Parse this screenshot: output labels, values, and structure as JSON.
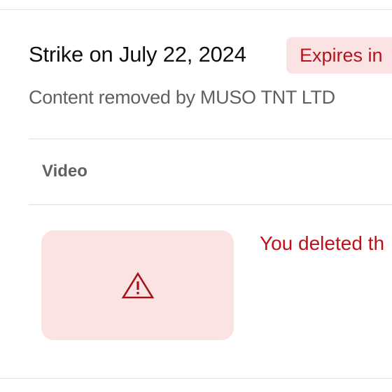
{
  "strike": {
    "title": "Strike on July 22, 2024",
    "badge": "Expires in",
    "removed_by": "Content removed by MUSO TNT LTD"
  },
  "table": {
    "header_video": "Video",
    "row": {
      "thumbnail_icon": "warning-triangle-icon",
      "status": "You deleted th"
    }
  },
  "colors": {
    "accent_red": "#c00f17",
    "badge_bg": "#fbe3e4"
  }
}
